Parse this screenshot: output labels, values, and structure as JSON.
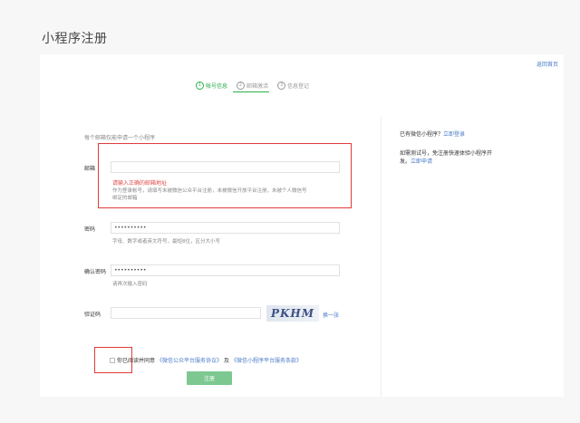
{
  "page": {
    "title": "小程序注册",
    "back_link": "返回首页"
  },
  "steps": [
    {
      "num": "1",
      "label": "帐号信息",
      "active": true
    },
    {
      "num": "2",
      "label": "邮箱激活",
      "active": false
    },
    {
      "num": "3",
      "label": "信息登记",
      "active": false
    }
  ],
  "form": {
    "hint": "每个邮箱仅能申请一个小程序",
    "email": {
      "label": "邮箱",
      "value": "",
      "error": "请输入正确的邮箱地址",
      "tip_line1": "作为登录帐号，请填写未被微信公众平台注册，未被微信开放平台注册，未被个人微信号",
      "tip_line2": "绑定的邮箱"
    },
    "password": {
      "label": "密码",
      "value": "••••••••••",
      "tip": "字母、数字或者英文符号，最短8位，区分大小写"
    },
    "confirm_password": {
      "label": "确认密码",
      "value": "••••••••••",
      "tip": "请再次输入密码"
    },
    "captcha": {
      "label": "验证码",
      "value": "",
      "image_text": "PKHM",
      "refresh": "换一张"
    },
    "agreement": {
      "prefix": "你已阅读并同意",
      "link1": "《微信公众平台服务协议》",
      "joiner": "及",
      "link2": "《微信小程序平台服务条款》"
    },
    "submit_label": "注册"
  },
  "side": {
    "line1_text": "已有微信小程序？",
    "line1_link": "立即登录",
    "line2_text": "如需测试号，免注册快速体验小程序开",
    "line3_text": "发。",
    "line3_link": "立即申请"
  },
  "colors": {
    "accent": "#2bb04a",
    "highlight": "#e03a3a",
    "link": "#4a7bc7",
    "error": "#e24a4a"
  }
}
